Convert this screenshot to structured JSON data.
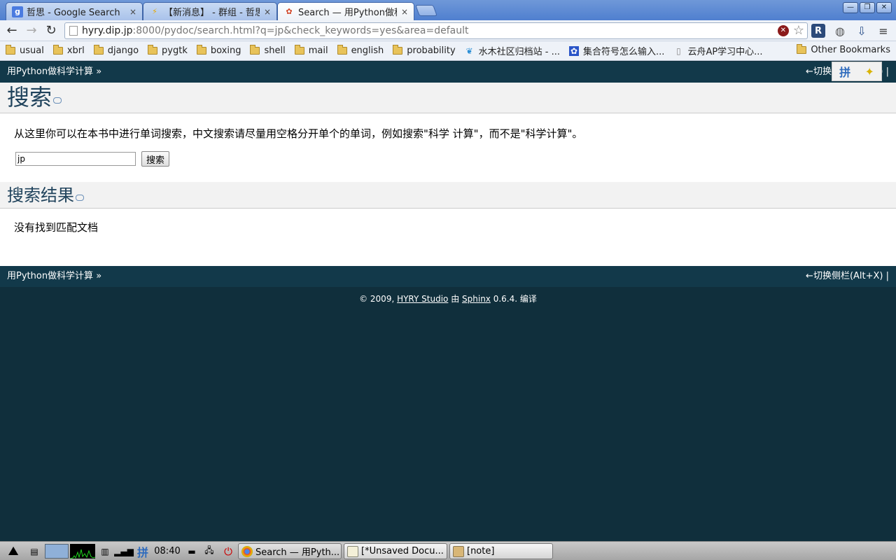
{
  "browser": {
    "tabs": [
      {
        "title": "哲思 - Google Search",
        "close": "×",
        "favicon": "google-icon",
        "active": false
      },
      {
        "title": "【新消息】 - 群组 - 哲思",
        "close": "×",
        "favicon": "lightning-icon",
        "active": false
      },
      {
        "title": "Search — 用Python做科",
        "close": "×",
        "favicon": "python-doc-icon",
        "active": true
      }
    ],
    "window_controls": {
      "minimize": "—",
      "restore": "❐",
      "close": "✕"
    },
    "nav": {
      "back": "←",
      "forward": "→",
      "reload": "↻"
    },
    "address": {
      "host": "hyry.dip.jp",
      "rest": ":8000/pydoc/search.html?q=jp&check_keywords=yes&area=default"
    },
    "extensions": {
      "r": "R",
      "globe": "◍",
      "download": "⇩",
      "menu": "≡"
    },
    "bookmarks": [
      {
        "label": "usual",
        "icon": "folder-icon"
      },
      {
        "label": "xbrl",
        "icon": "folder-icon"
      },
      {
        "label": "django",
        "icon": "folder-icon"
      },
      {
        "label": "pygtk",
        "icon": "folder-icon"
      },
      {
        "label": "boxing",
        "icon": "folder-icon"
      },
      {
        "label": "shell",
        "icon": "folder-icon"
      },
      {
        "label": "mail",
        "icon": "folder-icon"
      },
      {
        "label": "english",
        "icon": "folder-icon"
      },
      {
        "label": "probability",
        "icon": "folder-icon"
      },
      {
        "label": "水木社区归档站 - ...",
        "icon": "newsmth-icon"
      },
      {
        "label": "集合符号怎么输入...",
        "icon": "baidu-icon"
      },
      {
        "label": "云舟AP学习中心...",
        "icon": "page-icon"
      }
    ],
    "other_bookmarks": "Other Bookmarks"
  },
  "page": {
    "relbar_title": "用Python做科学计算 »",
    "relbar_toggle": "←切换侧栏(Alt+X) |",
    "heading": "搜索",
    "intro": "从这里你可以在本书中进行单词搜索，中文搜索请尽量用空格分开单个的单词，例如搜索\"科学 计算\"，而不是\"科学计算\"。",
    "search_value": "jp",
    "search_button": "搜索",
    "results_heading": "搜索结果",
    "no_results": "没有找到匹配文档",
    "footer": {
      "prefix": "© 2009, ",
      "author": "HYRY Studio",
      "mid": " 由 ",
      "sphinx": "Sphinx",
      "suffix": " 0.6.4. 编译"
    }
  },
  "ime": {
    "pin": "拼",
    "spark": "✦"
  },
  "taskbar": {
    "clock": "08:40",
    "ime": "拼",
    "tasks": [
      {
        "label": "Search — 用Pyth...",
        "icon": "chrome-icon",
        "active": true
      },
      {
        "label": "[*Unsaved Docu...",
        "icon": "text-editor-icon",
        "active": false
      },
      {
        "label": "[note]",
        "icon": "note-icon",
        "active": false
      }
    ]
  }
}
